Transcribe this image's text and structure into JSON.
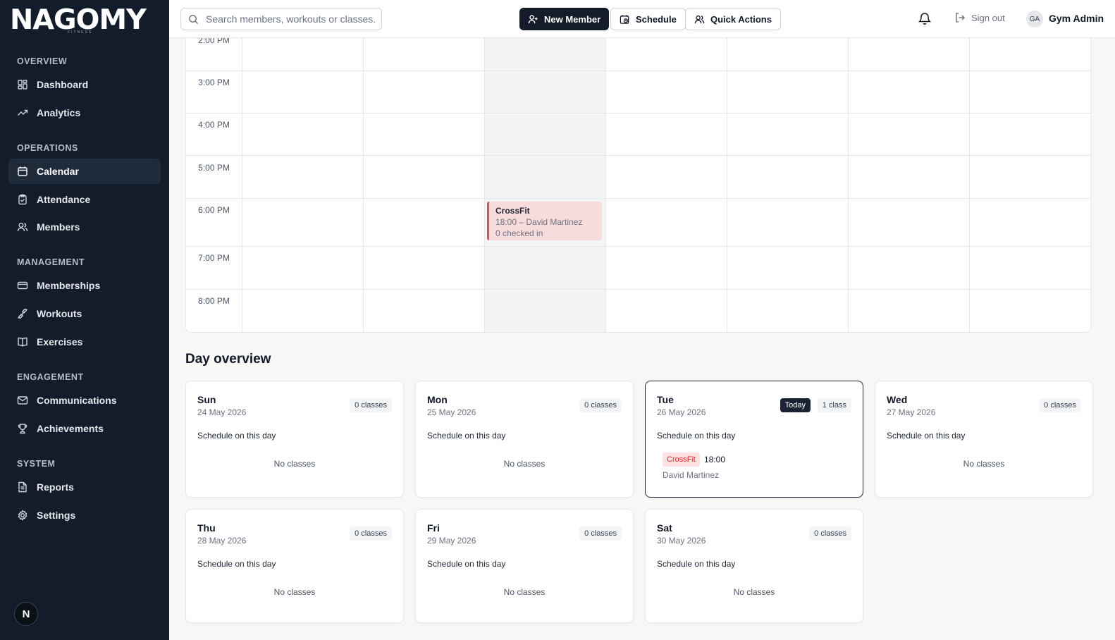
{
  "app": {
    "logo": "NAGOMY",
    "logo_sub": "FITNESS"
  },
  "sidebar": {
    "sections": [
      {
        "title": "OVERVIEW",
        "items": [
          {
            "label": "Dashboard",
            "icon": "dashboard-icon"
          },
          {
            "label": "Analytics",
            "icon": "trend-icon"
          }
        ]
      },
      {
        "title": "OPERATIONS",
        "items": [
          {
            "label": "Calendar",
            "icon": "calendar-icon",
            "active": true
          },
          {
            "label": "Attendance",
            "icon": "clipboard-icon"
          },
          {
            "label": "Members",
            "icon": "users-icon"
          }
        ]
      },
      {
        "title": "MANAGEMENT",
        "items": [
          {
            "label": "Memberships",
            "icon": "card-icon"
          },
          {
            "label": "Workouts",
            "icon": "dumbbell-icon"
          },
          {
            "label": "Exercises",
            "icon": "book-icon"
          }
        ]
      },
      {
        "title": "ENGAGEMENT",
        "items": [
          {
            "label": "Communications",
            "icon": "mail-icon"
          },
          {
            "label": "Achievements",
            "icon": "trophy-icon"
          }
        ]
      },
      {
        "title": "SYSTEM",
        "items": [
          {
            "label": "Reports",
            "icon": "report-icon"
          },
          {
            "label": "Settings",
            "icon": "gear-icon"
          }
        ]
      }
    ],
    "footer_avatar": "N"
  },
  "topbar": {
    "search_placeholder": "Search members, workouts or classes.",
    "new_member": "New Member",
    "schedule": "Schedule",
    "quick_actions": "Quick Actions",
    "sign_out": "Sign out",
    "user_initials": "GA",
    "user_name": "Gym Admin"
  },
  "calendar": {
    "times": [
      "2:00 PM",
      "3:00 PM",
      "4:00 PM",
      "5:00 PM",
      "6:00 PM",
      "7:00 PM",
      "8:00 PM"
    ],
    "event": {
      "title": "CrossFit",
      "line1": "18:00 – David Martinez",
      "line2": "0 checked in",
      "color": "#e05252"
    }
  },
  "overview": {
    "title": "Day overview",
    "schedule_label": "Schedule on this day",
    "no_classes": "No classes",
    "today_label": "Today",
    "days": [
      {
        "name": "Sun",
        "date": "24 May 2026",
        "count": "0 classes"
      },
      {
        "name": "Mon",
        "date": "25 May 2026",
        "count": "0 classes"
      },
      {
        "name": "Tue",
        "date": "26 May 2026",
        "count": "1 class",
        "today": true,
        "class_name": "CrossFit",
        "class_time": "18:00",
        "coach": "David Martinez"
      },
      {
        "name": "Wed",
        "date": "27 May 2026",
        "count": "0 classes"
      },
      {
        "name": "Thu",
        "date": "28 May 2026",
        "count": "0 classes"
      },
      {
        "name": "Fri",
        "date": "29 May 2026",
        "count": "0 classes"
      },
      {
        "name": "Sat",
        "date": "30 May 2026",
        "count": "0 classes"
      }
    ]
  }
}
